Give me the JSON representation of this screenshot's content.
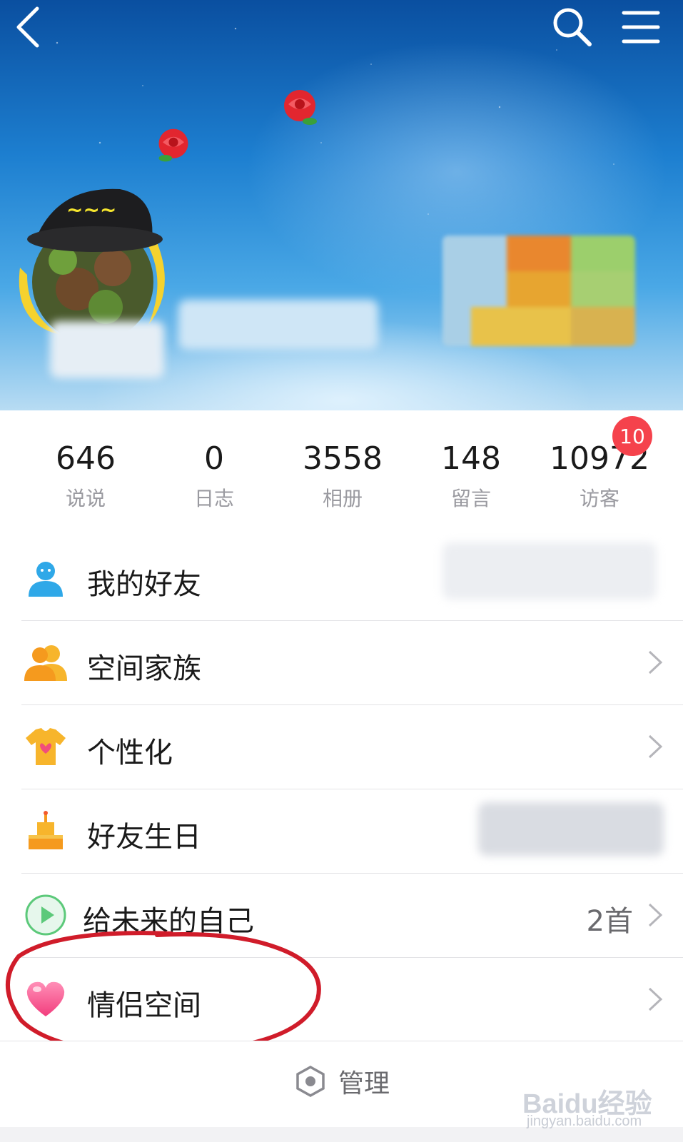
{
  "header": {
    "back_icon": "chevron-left-icon",
    "search_icon": "search-icon",
    "menu_icon": "hamburger-menu-icon"
  },
  "stats": [
    {
      "value": "646",
      "label": "说说"
    },
    {
      "value": "0",
      "label": "日志"
    },
    {
      "value": "3558",
      "label": "相册"
    },
    {
      "value": "148",
      "label": "留言"
    },
    {
      "value": "10972",
      "label": "访客"
    }
  ],
  "visitor_badge": "10",
  "menu": {
    "items": [
      {
        "label": "我的好友",
        "icon": "user-icon"
      },
      {
        "label": "空间家族",
        "icon": "family-icon"
      },
      {
        "label": "个性化",
        "icon": "tshirt-icon"
      },
      {
        "label": "好友生日",
        "icon": "birthday-cake-icon"
      },
      {
        "label": "给未来的自己",
        "icon": "play-icon",
        "value": "2首"
      },
      {
        "label": "情侣空间",
        "icon": "heart-icon"
      }
    ]
  },
  "footer": {
    "manage_label": "管理",
    "manage_icon": "hexagon-settings-icon"
  },
  "watermark": {
    "logo": "Baidu经验",
    "url": "jingyan.baidu.com"
  },
  "colors": {
    "badge": "#f5424c",
    "annotation": "#d01c2a",
    "label_gray": "#9a9aa0"
  }
}
